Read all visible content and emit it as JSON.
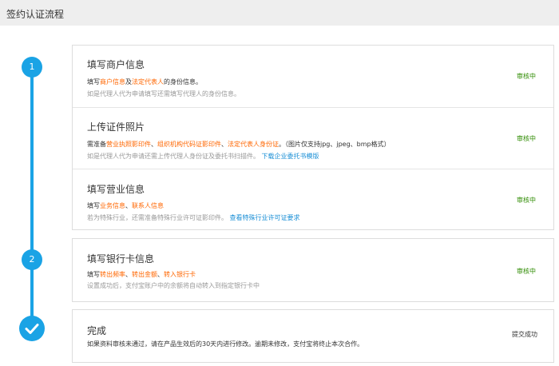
{
  "header": {
    "title": "签约认证流程"
  },
  "timeline": {
    "step1": "1",
    "step2": "2",
    "done_icon": "check-icon",
    "accent": "#1aa3e5"
  },
  "card1": {
    "merchant": {
      "title": "填写商户信息",
      "l1a": "填写",
      "l1b": "商户信息",
      "l1c": "及",
      "l1d": "法定代表人",
      "l1e": "的身份信息。",
      "line2": "如是代理人代为申请填写还需填写代理人的身份信息。",
      "status": "审核中"
    },
    "certificate": {
      "title": "上传证件照片",
      "l1a": "需准备",
      "l1b": "营业执照影印件",
      "l1c": "、",
      "l1d": "组织机构代码证影印件",
      "l1e": "、",
      "l1f": "法定代表人身份证",
      "l1g": "。（图片仅支持jpg、jpeg、bmp格式）",
      "l2a": "如是代理人代为申请还需上传代理人身份证及委托书扫描件。",
      "l2b": "下载企业委托书模版",
      "status": "审核中"
    },
    "business": {
      "title": "填写营业信息",
      "l1a": "填写",
      "l1b": "业务信息",
      "l1c": "、",
      "l1d": "联系人信息",
      "l2a": "若为特殊行业，还需准备特殊行业许可证影印件。",
      "l2b": "查看特殊行业许可证要求",
      "status": "审核中"
    }
  },
  "card2": {
    "title": "填写银行卡信息",
    "l1a": "填写",
    "l1b": "转出频率",
    "l1c": "、",
    "l1d": "转出金额",
    "l1e": "、",
    "l1f": "转入银行卡",
    "line2": "设置成功后，支付宝账户中的余额将自动转入到指定银行卡中",
    "status": "审核中"
  },
  "card3": {
    "title": "完成",
    "line1": "如果资料审核未通过，请在产品生效后的30天内进行修改。逾期未修改，支付宝将终止本次合作。",
    "status": "提交成功"
  }
}
